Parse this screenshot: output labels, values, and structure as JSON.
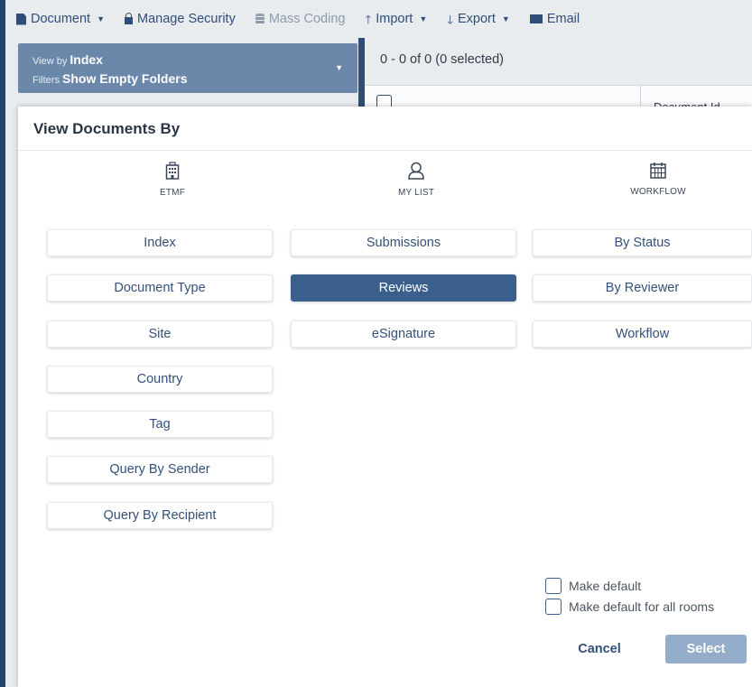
{
  "toolbar": {
    "document": "Document",
    "manage_security": "Manage Security",
    "mass_coding": "Mass Coding",
    "import": "Import",
    "export": "Export",
    "email": "Email"
  },
  "view_panel": {
    "view_by_label": "View by",
    "view_by_value": "Index",
    "filters_label": "Filters",
    "filters_value": "Show Empty Folders"
  },
  "grid": {
    "count_text": "0 - 0 of 0 (0 selected)",
    "col_document_id": "Document Id"
  },
  "modal": {
    "title": "View Documents By",
    "columns": [
      {
        "label": "ETMF",
        "icon": "building-icon"
      },
      {
        "label": "MY LIST",
        "icon": "user-icon"
      },
      {
        "label": "WORKFLOW",
        "icon": "calendar-icon"
      }
    ],
    "etmf_options": [
      "Index",
      "Document Type",
      "Site",
      "Country",
      "Tag",
      "Query By Sender",
      "Query By Recipient"
    ],
    "mylist_options": [
      "Submissions",
      "Reviews",
      "eSignature"
    ],
    "workflow_options": [
      "By Status",
      "By Reviewer",
      "Workflow"
    ],
    "selected_option": "Reviews",
    "make_default": "Make default",
    "make_default_all": "Make default for all rooms",
    "cancel": "Cancel",
    "select": "Select"
  },
  "colors": {
    "accent": "#3a5f8d",
    "toolbar_text": "#2f4d78",
    "select_disabled": "#93acc9"
  }
}
